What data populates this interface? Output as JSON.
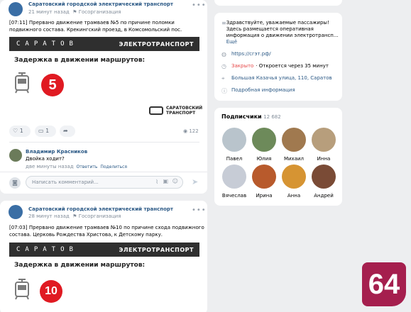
{
  "posts": [
    {
      "author": "Саратовский городской электрический транспорт",
      "time": "21 минут назад",
      "org": "Госорганизация",
      "text": "[07:11] Прервано движение трамваев №5 по причине поломки подвижного состава. Крекингский проезд, в Комсомольский пос.",
      "banner_city": "САРАТОВ",
      "banner_brand": "ЭЛЕКТРОТРАНСПОРТ",
      "delay_title": "Задержка в движении маршрутов:",
      "route": "5",
      "brand_logo_1": "САРАТОВСКИЙ",
      "brand_logo_2": "ТРАНСПОРТ",
      "likes": "1",
      "comments": "1",
      "views": "122"
    },
    {
      "author": "Саратовский городской электрический транспорт",
      "time": "28 минут назад",
      "org": "Госорганизация",
      "text": "[07:03] Прервано движение трамваев №10 по причине схода подвижного состава. Церковь Рождества Христова, к Детскому парку.",
      "banner_city": "САРАТОВ",
      "banner_brand": "ЭЛЕКТРОТРАНСПОРТ",
      "delay_title": "Задержка в движении маршрутов:",
      "route": "10"
    }
  ],
  "comment": {
    "author": "Владимир Красников",
    "text": "Двойка ходит?",
    "time": "две минуты назад",
    "reply": "Ответить",
    "share": "Поделиться"
  },
  "comment_input": {
    "placeholder": "Написать комментарий..."
  },
  "info": {
    "description": "Здравствуйте, уважаемые пассажиры! Здесь размещается оперативная информация о движении электротрансп...",
    "more": "Ещё",
    "site": "https://cгэт.рф/",
    "status_closed": "Закрыто",
    "status_opens": "· Откроется через 35 минут",
    "address": "Большая Казачья улица, 110, Саратов",
    "details": "Подробная информация"
  },
  "subscribers": {
    "title": "Подписчики",
    "count": "12 682",
    "people": [
      "Павел",
      "Юлия",
      "Михаил",
      "Инна",
      "Вячеслав",
      "Ирина",
      "Анна",
      "Андрей"
    ]
  },
  "logo": "64",
  "colors": {
    "link": "#2a5885",
    "accent": "#e01a22",
    "logo_bg": "#a51f4e",
    "closed": "#e64646"
  }
}
